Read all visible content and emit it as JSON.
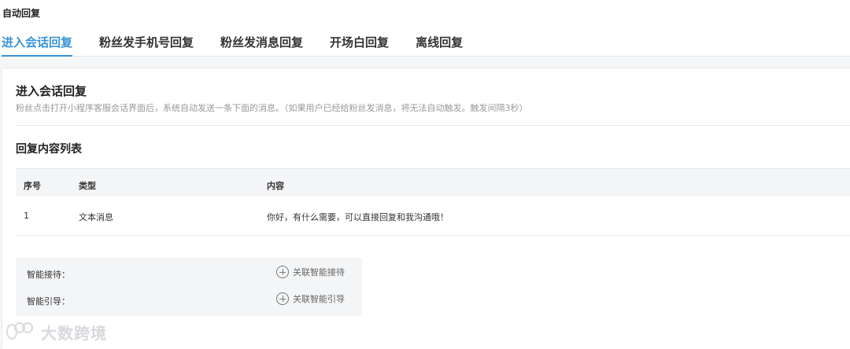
{
  "page": {
    "title": "自动回复"
  },
  "tabs": [
    {
      "label": "进入会话回复",
      "active": true
    },
    {
      "label": "粉丝发手机号回复",
      "active": false
    },
    {
      "label": "粉丝发消息回复",
      "active": false
    },
    {
      "label": "开场白回复",
      "active": false
    },
    {
      "label": "离线回复",
      "active": false
    }
  ],
  "section": {
    "title": "进入会话回复",
    "description": "粉丝点击打开小程序客服会话界面后，系统自动发送一条下面的消息。（如果用户已经给粉丝发消息，将无法自动触发。触发间隔3秒）"
  },
  "reply_list": {
    "title": "回复内容列表",
    "columns": [
      "序号",
      "类型",
      "内容"
    ],
    "rows": [
      [
        "1",
        "文本消息",
        "你好，有什么需要，可以直接回复和我沟通哦！"
      ]
    ]
  },
  "smart": {
    "items": [
      {
        "label": "智能接待：",
        "link": "关联智能接待",
        "icon": "plus-circle-icon"
      },
      {
        "label": "智能引导：",
        "link": "关联智能引导",
        "icon": "plus-circle-icon"
      }
    ]
  },
  "watermark": {
    "text": "大数跨境"
  },
  "colors": {
    "accent": "#3a93d8",
    "muted": "#999999",
    "table_header_bg": "#f4f5f7"
  }
}
